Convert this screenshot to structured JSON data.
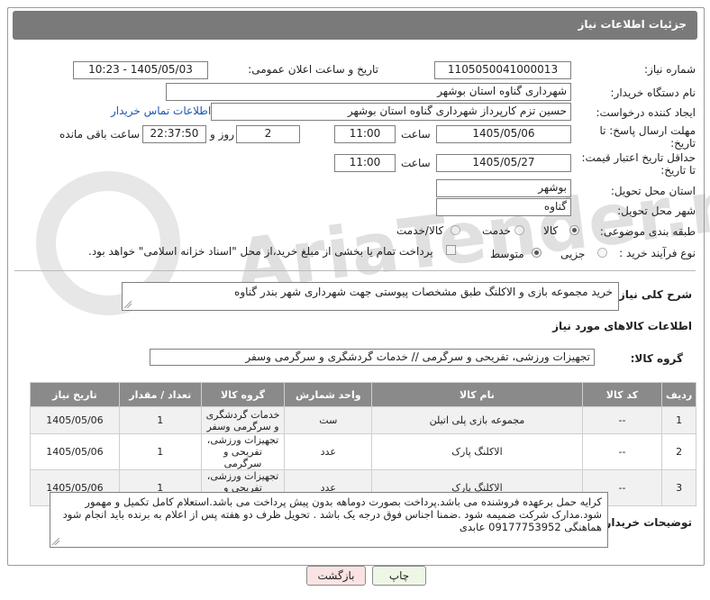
{
  "page": {
    "title": "جزئیات اطلاعات نیاز"
  },
  "watermark": "AriaTender.neT",
  "fields": {
    "need_number_label": "شماره نیاز:",
    "need_number": "1105050041000013",
    "announce_label": "تاریخ و ساعت اعلان عمومی:",
    "announce_value": "1405/05/03 - 10:23",
    "buyer_org_label": "نام دستگاه خریدار:",
    "buyer_org": "شهرداری گناوه استان بوشهر",
    "creator_label": "ایجاد کننده درخواست:",
    "creator": "حسین تزم کارپرداز شهرداری گناوه استان بوشهر",
    "contact_link": "اطلاعات تماس خریدار",
    "deadline_label_1": "مهلت ارسال پاسخ: تا",
    "deadline_label_2": "تاریخ:",
    "deadline_date": "1405/05/06",
    "time_label": "ساعت",
    "deadline_time": "11:00",
    "days_value": "2",
    "days_label": "روز و",
    "remaining_value": "22:37:50",
    "remaining_label": "ساعت باقی مانده",
    "validity_label_1": "حداقل تاریخ اعتبار قیمت:",
    "validity_label_2": "تا تاریخ:",
    "validity_date": "1405/05/27",
    "validity_time": "11:00",
    "province_label": "استان محل تحویل:",
    "province": "بوشهر",
    "city_label": "شهر محل تحویل:",
    "city": "گناوه",
    "category_label": "طبقه بندی موضوعی:",
    "category_options": [
      "کالا",
      "خدمت",
      "کالا/خدمت"
    ],
    "category_selected": "کالا",
    "process_label": "نوع فرآیند خرید :",
    "process_options": [
      "جزیی",
      "متوسط"
    ],
    "process_selected": "متوسط",
    "payment_text": "پرداخت تمام یا بخشی از مبلغ خرید،از محل \"اسناد خزانه اسلامی\" خواهد بود."
  },
  "summary": {
    "label": "شرح کلی نیاز:",
    "text": "خرید مجموعه بازی و الاکلنگ طبق مشخصات پیوستی جهت شهرداری شهر بندر گناوه"
  },
  "goods_section": {
    "title": "اطلاعات کالاهای مورد نیاز",
    "group_label": "گروه کالا:",
    "group_value": "تجهیزات ورزشی، تفریحی و سرگرمی // خدمات گردشگری و سرگرمی وسفر"
  },
  "table": {
    "headers": [
      "ردیف",
      "کد کالا",
      "نام کالا",
      "واحد شمارش",
      "گروه کالا",
      "تعداد / مقدار",
      "تاریخ نیاز"
    ],
    "rows": [
      {
        "row": "1",
        "code": "--",
        "name": "مجموعه بازی پلی اتیلن",
        "unit": "ست",
        "group": "خدمات گردشگری و سرگرمی وسفر",
        "qty": "1",
        "date": "1405/05/06"
      },
      {
        "row": "2",
        "code": "--",
        "name": "الاکلنگ پارک",
        "unit": "عدد",
        "group": "تجهیزات ورزشی، تفریحی و سرگرمی",
        "qty": "1",
        "date": "1405/05/06"
      },
      {
        "row": "3",
        "code": "--",
        "name": "الاکلنگ پارک",
        "unit": "عدد",
        "group": "تجهیزات ورزشی، تفریحی و سرگرمی",
        "qty": "1",
        "date": "1405/05/06"
      }
    ]
  },
  "buyer_notes": {
    "label": "توضیحات خریدار:",
    "text": "کرایه حمل برعهده فروشنده می باشد.پرداخت بصورت دوماهه بدون پیش پرداخت می باشد.استعلام کامل تکمیل و مهمور شود.مدارک شرکت ضمیمه شود .ضمنا اجناس فوق درجه یک باشد . تحویل ظرف دو هفته پس از اعلام به برنده باید انجام شود هماهنگی 09177753952 عابدی"
  },
  "buttons": {
    "print": "چاپ",
    "back": "بازگشت"
  }
}
